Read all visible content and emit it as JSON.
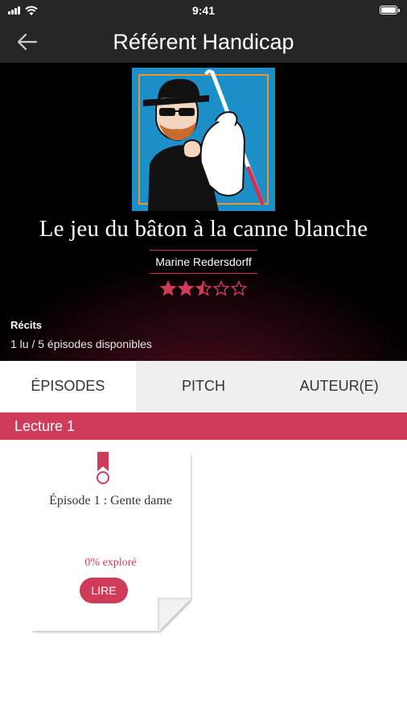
{
  "status_bar": {
    "time": "9:41"
  },
  "nav": {
    "title": "Référent Handicap"
  },
  "book": {
    "title": "Le jeu du bâton à la canne blanche",
    "author": "Marine Redersdorff",
    "rating": 2.5,
    "rating_max": 5,
    "section_label": "Récits",
    "progress_text": "1 lu / 5 épisodes disponibles"
  },
  "tabs": [
    {
      "label": "ÉPISODES",
      "active": true
    },
    {
      "label": "PITCH",
      "active": false
    },
    {
      "label": "AUTEUR(E)",
      "active": false
    }
  ],
  "lecture": {
    "label": "Lecture 1"
  },
  "episodes": [
    {
      "title": "Épisode 1 : Gente dame",
      "explored": "0% exploré",
      "button_label": "LIRE"
    }
  ],
  "colors": {
    "accent": "#d13b5a",
    "bar_dark": "#262626",
    "cover_blue": "#1d8fc8",
    "cover_frame": "#f0922e"
  },
  "icons": {
    "back": "arrow-left-icon",
    "star": "star-icon",
    "bookmark": "bookmark-icon"
  }
}
